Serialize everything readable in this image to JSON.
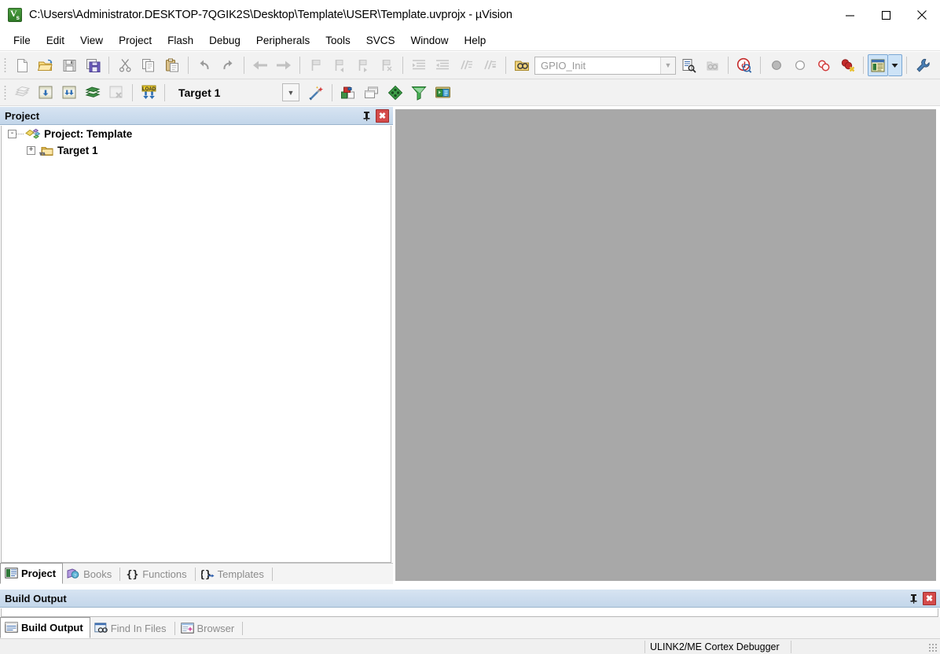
{
  "window": {
    "title": "C:\\Users\\Administrator.DESKTOP-7QGIK2S\\Desktop\\Template\\USER\\Template.uvprojx - µVision",
    "app_icon": "uvision-logo-icon",
    "controls": {
      "minimize": "minimize-button",
      "maximize": "maximize-button",
      "close": "close-button"
    }
  },
  "menubar": {
    "items": [
      {
        "label": "File"
      },
      {
        "label": "Edit"
      },
      {
        "label": "View"
      },
      {
        "label": "Project"
      },
      {
        "label": "Flash"
      },
      {
        "label": "Debug"
      },
      {
        "label": "Peripherals"
      },
      {
        "label": "Tools"
      },
      {
        "label": "SVCS"
      },
      {
        "label": "Window"
      },
      {
        "label": "Help"
      }
    ]
  },
  "toolbar_main": {
    "find_combo": {
      "value": "GPIO_Init",
      "placeholder": "GPIO_Init"
    },
    "buttons": [
      {
        "name": "new-file-icon",
        "tip": "New"
      },
      {
        "name": "open-file-icon",
        "tip": "Open"
      },
      {
        "name": "save-icon",
        "tip": "Save"
      },
      {
        "name": "save-all-icon",
        "tip": "Save All"
      },
      {
        "name": "cut-icon",
        "tip": "Cut"
      },
      {
        "name": "copy-icon",
        "tip": "Copy"
      },
      {
        "name": "paste-icon",
        "tip": "Paste"
      },
      {
        "name": "undo-icon",
        "tip": "Undo"
      },
      {
        "name": "redo-icon",
        "tip": "Redo"
      },
      {
        "name": "navigate-backward-icon",
        "tip": "Back"
      },
      {
        "name": "navigate-forward-icon",
        "tip": "Forward"
      },
      {
        "name": "bookmark-toggle-icon",
        "tip": "Insert/Remove Bookmark"
      },
      {
        "name": "bookmark-previous-icon",
        "tip": "Go to Previous Bookmark"
      },
      {
        "name": "bookmark-next-icon",
        "tip": "Go to Next Bookmark"
      },
      {
        "name": "bookmark-clear-icon",
        "tip": "Clear All Bookmarks"
      },
      {
        "name": "indent-icon",
        "tip": "Indent Selected Text"
      },
      {
        "name": "outdent-icon",
        "tip": "Unindent Selected Text"
      },
      {
        "name": "comment-icon",
        "tip": "Comment Selection"
      },
      {
        "name": "uncomment-icon",
        "tip": "Uncomment Selection"
      },
      {
        "name": "find-in-files-icon",
        "tip": "Find in Files"
      },
      {
        "name": "incremental-find-icon",
        "tip": "Incremental Find"
      },
      {
        "name": "bookmark-binoculars-icon",
        "tip": "Find"
      },
      {
        "name": "debug-session-icon",
        "tip": "Start/Stop Debug Session"
      },
      {
        "name": "breakpoint-insert-icon",
        "tip": "Insert/Remove Breakpoint"
      },
      {
        "name": "breakpoint-enable-icon",
        "tip": "Enable/Disable Breakpoint"
      },
      {
        "name": "breakpoint-disable-all-icon",
        "tip": "Disable All Breakpoints"
      },
      {
        "name": "breakpoint-kill-all-icon",
        "tip": "Kill All Breakpoints"
      },
      {
        "name": "configure-window-icon",
        "tip": "Configuration Wizard",
        "checked": true
      },
      {
        "name": "configure-dropdown-icon",
        "tip": "More"
      },
      {
        "name": "customize-tools-icon",
        "tip": "Customize Tools Menu"
      }
    ]
  },
  "toolbar_build": {
    "target_value": "Target 1",
    "buttons": [
      {
        "name": "translate-file-icon",
        "tip": "Translate"
      },
      {
        "name": "build-target-icon",
        "tip": "Build"
      },
      {
        "name": "rebuild-all-icon",
        "tip": "Rebuild"
      },
      {
        "name": "batch-build-icon",
        "tip": "Batch Build"
      },
      {
        "name": "stop-build-icon",
        "tip": "Stop Build"
      },
      {
        "name": "download-load-icon",
        "tip": "Download"
      },
      {
        "name": "target-dropdown-icon",
        "tip": "Select Target"
      },
      {
        "name": "target-options-wand-icon",
        "tip": "Options for Target"
      },
      {
        "name": "manage-project-items-icon",
        "tip": "Manage Project Items"
      },
      {
        "name": "multi-project-icon",
        "tip": "Manage Multi-Project"
      },
      {
        "name": "run-time-environment-icon",
        "tip": "Manage Run-Time Environment"
      },
      {
        "name": "pack-filter-icon",
        "tip": "Pack Filter"
      },
      {
        "name": "pack-installer-icon",
        "tip": "Pack Installer"
      }
    ]
  },
  "project_panel": {
    "caption": "Project",
    "pin_icon": "pin-icon",
    "close_icon": "close-icon",
    "tree": [
      {
        "label": "Project: Template",
        "expander": "-",
        "icon": "project-node-icon",
        "level": 0
      },
      {
        "label": "Target 1",
        "expander": "+",
        "icon": "target-folder-icon",
        "level": 1
      }
    ],
    "tabs": [
      {
        "label": "Project",
        "icon": "project-tab-icon",
        "active": true
      },
      {
        "label": "Books",
        "icon": "books-tab-icon",
        "active": false
      },
      {
        "label": "Functions",
        "icon": "functions-tab-icon",
        "active": false
      },
      {
        "label": "Templates",
        "icon": "templates-tab-icon",
        "active": false
      }
    ]
  },
  "build_panel": {
    "caption": "Build Output",
    "pin_icon": "pin-icon",
    "close_icon": "close-icon",
    "content": "",
    "tabs": [
      {
        "label": "Build Output",
        "icon": "build-output-tab-icon",
        "active": true
      },
      {
        "label": "Find In Files",
        "icon": "find-in-files-tab-icon",
        "active": false
      },
      {
        "label": "Browser",
        "icon": "browser-tab-icon",
        "active": false
      }
    ]
  },
  "statusbar": {
    "message": "",
    "debugger": "ULINK2/ME Cortex Debugger",
    "resize_grip": "resize-grip-icon"
  },
  "colors": {
    "caption_gradient_top": "#d7e4f2",
    "caption_gradient_bottom": "#c3d6ea",
    "mdi_background": "#a8a8a8",
    "toolbar_background": "#f2f2f2",
    "close_button_red": "#d44b4b"
  }
}
